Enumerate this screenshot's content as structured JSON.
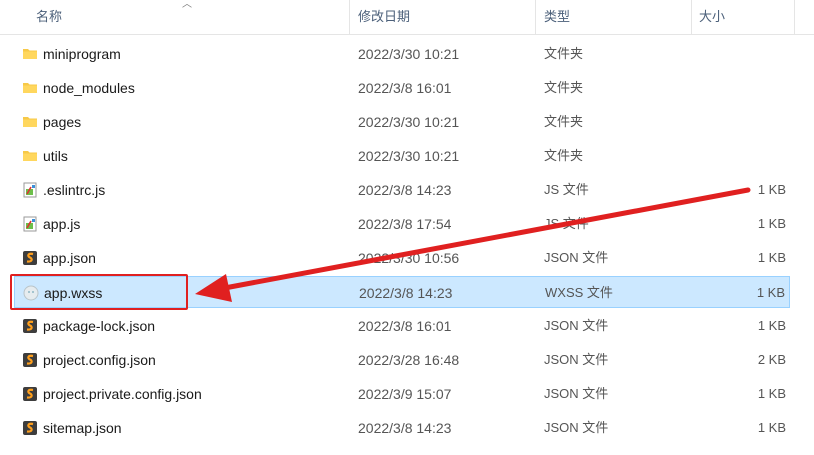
{
  "header": {
    "name": "名称",
    "date": "修改日期",
    "type": "类型",
    "size": "大小"
  },
  "files": [
    {
      "name": "miniprogram",
      "date": "2022/3/30 10:21",
      "type": "文件夹",
      "size": "",
      "icon": "folder-icon"
    },
    {
      "name": "node_modules",
      "date": "2022/3/8 16:01",
      "type": "文件夹",
      "size": "",
      "icon": "folder-icon"
    },
    {
      "name": "pages",
      "date": "2022/3/30 10:21",
      "type": "文件夹",
      "size": "",
      "icon": "folder-icon"
    },
    {
      "name": "utils",
      "date": "2022/3/30 10:21",
      "type": "文件夹",
      "size": "",
      "icon": "folder-icon"
    },
    {
      "name": ".eslintrc.js",
      "date": "2022/3/8 14:23",
      "type": "JS 文件",
      "size": "1 KB",
      "icon": "js-file-icon"
    },
    {
      "name": "app.js",
      "date": "2022/3/8 17:54",
      "type": "JS 文件",
      "size": "1 KB",
      "icon": "js-file-icon"
    },
    {
      "name": "app.json",
      "date": "2022/3/30 10:56",
      "type": "JSON 文件",
      "size": "1 KB",
      "icon": "json-file-icon"
    },
    {
      "name": "app.wxss",
      "date": "2022/3/8 14:23",
      "type": "WXSS 文件",
      "size": "1 KB",
      "icon": "wxss-file-icon",
      "selected": true
    },
    {
      "name": "package-lock.json",
      "date": "2022/3/8 16:01",
      "type": "JSON 文件",
      "size": "1 KB",
      "icon": "json-file-icon"
    },
    {
      "name": "project.config.json",
      "date": "2022/3/28 16:48",
      "type": "JSON 文件",
      "size": "2 KB",
      "icon": "json-file-icon"
    },
    {
      "name": "project.private.config.json",
      "date": "2022/3/9 15:07",
      "type": "JSON 文件",
      "size": "1 KB",
      "icon": "json-file-icon"
    },
    {
      "name": "sitemap.json",
      "date": "2022/3/8 14:23",
      "type": "JSON 文件",
      "size": "1 KB",
      "icon": "json-file-icon"
    }
  ],
  "colors": {
    "selection": "#cce8ff",
    "annotation": "#e02020",
    "folder": "#f7c948"
  }
}
